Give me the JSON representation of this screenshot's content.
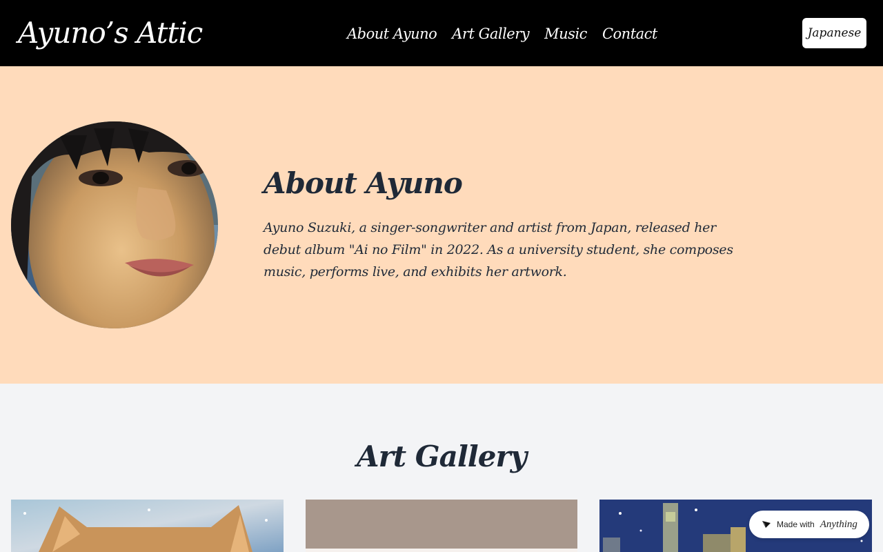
{
  "header": {
    "logo": "Ayuno’s Attic",
    "nav": [
      "About Ayuno",
      "Art Gallery",
      "Music",
      "Contact"
    ],
    "language_button": "Japanese"
  },
  "about": {
    "title": "About Ayuno",
    "text": "Ayuno Suzuki, a singer-songwriter and artist from Japan, released her debut album \"Ai no Film\" in 2022. As a university student, she composes music, performs live, and exhibits her artwork."
  },
  "gallery": {
    "title": "Art Gallery"
  },
  "badge": {
    "prefix": "Made with",
    "brand": "Anything"
  }
}
